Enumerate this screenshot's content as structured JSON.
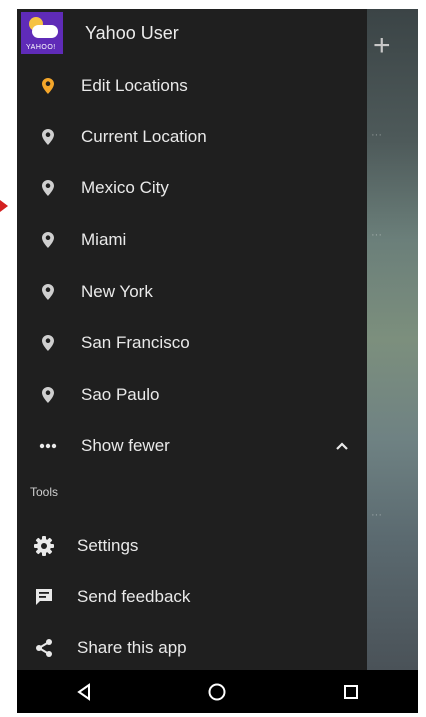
{
  "header": {
    "user_name": "Yahoo User",
    "app_badge": "YAHOO!"
  },
  "locations": [
    {
      "label": "Edit Locations",
      "icon": "map-pin-icon",
      "color": "#f4a62a"
    },
    {
      "label": "Current Location",
      "icon": "map-pin-icon",
      "color": "#cfcfcf"
    },
    {
      "label": "Mexico City",
      "icon": "map-pin-icon",
      "color": "#cfcfcf"
    },
    {
      "label": "Miami",
      "icon": "map-pin-icon",
      "color": "#cfcfcf"
    },
    {
      "label": "New York",
      "icon": "map-pin-icon",
      "color": "#cfcfcf"
    },
    {
      "label": "San Francisco",
      "icon": "map-pin-icon",
      "color": "#cfcfcf"
    },
    {
      "label": "Sao Paulo",
      "icon": "map-pin-icon",
      "color": "#cfcfcf"
    }
  ],
  "show_fewer": {
    "label": "Show fewer",
    "icon": "more-horizontal-icon"
  },
  "tools": {
    "section_label": "Tools",
    "items": [
      {
        "label": "Settings",
        "icon": "gear-icon"
      },
      {
        "label": "Send feedback",
        "icon": "feedback-icon"
      },
      {
        "label": "Share this app",
        "icon": "share-icon"
      }
    ]
  },
  "colors": {
    "drawer_bg": "#1f1f1f",
    "accent": "#f4a62a",
    "avatar_bg": "#5f2bb8"
  }
}
